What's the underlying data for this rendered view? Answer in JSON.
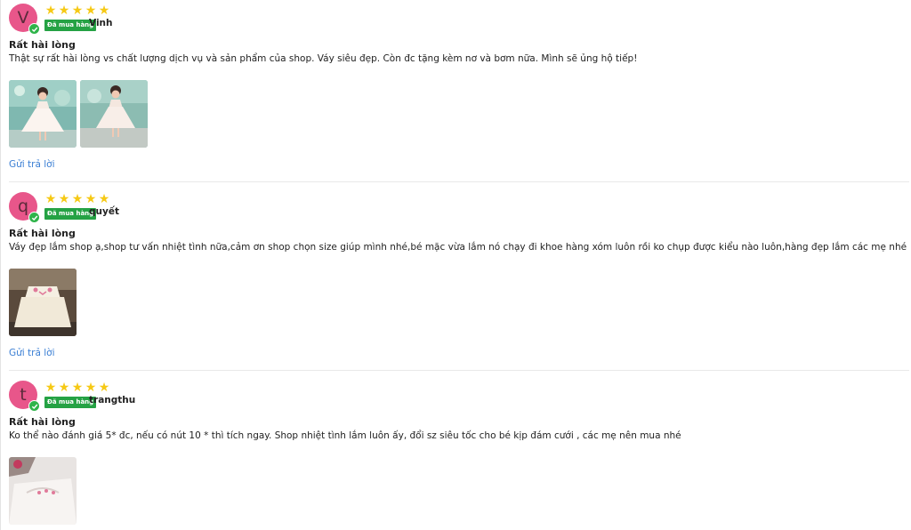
{
  "reviews": [
    {
      "avatar_letter": "V",
      "stars": 5,
      "badge": "Đã mua hàng",
      "username": "Vinh",
      "title": "Rất hài lòng",
      "body": "Thật sự rất hài lòng vs chất lượng dịch vụ và sản phẩm của shop. Váy siêu đẹp. Còn đc tặng kèm nơ và bơm nữa. Mình sẽ ủng hộ tiếp!",
      "reply": "Gửi trả lời"
    },
    {
      "avatar_letter": "q",
      "stars": 5,
      "badge": "Đã mua hàng",
      "username": "quyết",
      "title": "Rất hài lòng",
      "body": "Váy đẹp lắm shop ạ,shop tư vấn nhiệt tình nữa,cảm ơn shop chọn size giúp mình nhé,bé mặc vừa lắm nó chạy đi khoe hàng xóm luôn rồi ko chụp được kiểu nào luôn,hàng đẹp lắm các mẹ nhé",
      "reply": "Gửi trả lời"
    },
    {
      "avatar_letter": "t",
      "stars": 5,
      "badge": "Đã mua hàng",
      "username": "trangthu",
      "title": "Rất hài lòng",
      "body": "Ko thể nào đánh giá 5* đc, nếu có nút 10 * thì tích ngay. Shop nhiệt tình lắm luôn ấy, đổi sz siêu tốc cho bé kịp đám cưới , các mẹ nên mua nhé"
    }
  ],
  "colors": {
    "star": "#f6c915",
    "badge": "#25a244",
    "avatar": "#e8568a",
    "reply_link": "#3b7fd4"
  }
}
